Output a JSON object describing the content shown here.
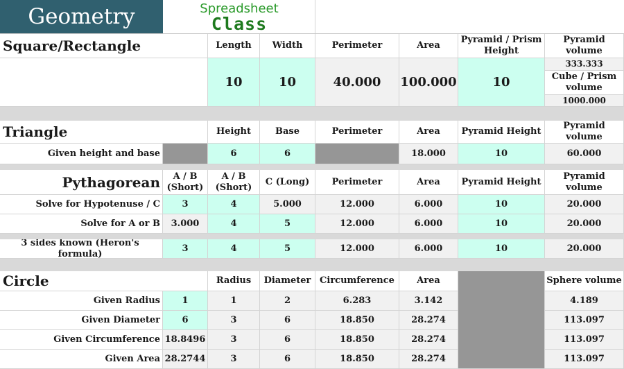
{
  "header": {
    "title": "Geometry",
    "brand_line1": "Spreadsheet",
    "brand_line2": "Class"
  },
  "square": {
    "title": "Square/Rectangle",
    "headers": {
      "length": "Length",
      "width": "Width",
      "perimeter": "Perimeter",
      "area": "Area",
      "height": "Pyramid / Prism Height",
      "pyr_vol": "Pyramid volume",
      "cube_vol": "Cube / Prism volume"
    },
    "values": {
      "length": "10",
      "width": "10",
      "perimeter": "40.000",
      "area": "100.000",
      "height": "10",
      "pyr_vol": "333.333",
      "cube_vol": "1000.000"
    }
  },
  "triangle": {
    "title": "Triangle",
    "headers": {
      "height": "Height",
      "base": "Base",
      "perimeter": "Perimeter",
      "area": "Area",
      "pyr_height": "Pyramid Height",
      "pyr_vol": "Pyramid volume"
    },
    "row": {
      "label": "Given height and base",
      "height": "6",
      "base": "6",
      "area": "18.000",
      "pyr_height": "10",
      "pyr_vol": "60.000"
    }
  },
  "pythagorean": {
    "title": "Pythagorean",
    "headers": {
      "a": "A / B (Short)",
      "b": "A / B (Short)",
      "c": "C (Long)",
      "perimeter": "Perimeter",
      "area": "Area",
      "pyr_height": "Pyramid Height",
      "pyr_vol": "Pyramid volume"
    },
    "rows": [
      {
        "label": "Solve for Hypotenuse / C",
        "a": "3",
        "b": "4",
        "c": "5.000",
        "perimeter": "12.000",
        "area": "6.000",
        "pyr_height": "10",
        "pyr_vol": "20.000"
      },
      {
        "label": "Solve for A or B",
        "a": "3.000",
        "b": "4",
        "c": "5",
        "perimeter": "12.000",
        "area": "6.000",
        "pyr_height": "10",
        "pyr_vol": "20.000"
      }
    ],
    "heron": {
      "label": "3 sides known (Heron's formula)",
      "a": "3",
      "b": "4",
      "c": "5",
      "perimeter": "12.000",
      "area": "6.000",
      "pyr_height": "10",
      "pyr_vol": "20.000"
    }
  },
  "circle": {
    "title": "Circle",
    "headers": {
      "radius": "Radius",
      "diameter": "Diameter",
      "circumference": "Circumference",
      "area": "Area",
      "sphere": "Sphere volume"
    },
    "rows": [
      {
        "label": "Given Radius",
        "input": "1",
        "radius": "1",
        "diameter": "2",
        "circumference": "6.283",
        "area": "3.142",
        "sphere": "4.189"
      },
      {
        "label": "Given Diameter",
        "input": "6",
        "radius": "3",
        "diameter": "6",
        "circumference": "18.850",
        "area": "28.274",
        "sphere": "113.097"
      },
      {
        "label": "Given Circumference",
        "input": "18.8496",
        "radius": "3",
        "diameter": "6",
        "circumference": "18.850",
        "area": "28.274",
        "sphere": "113.097"
      },
      {
        "label": "Given Area",
        "input": "28.2744",
        "radius": "3",
        "diameter": "6",
        "circumference": "18.850",
        "area": "28.274",
        "sphere": "113.097"
      }
    ]
  },
  "colors": {
    "header_bg": "#30606f",
    "input_bg": "#ccfff0",
    "output_bg": "#f1f1f1",
    "blocked_bg": "#969696",
    "band_bg": "#d9d9d9"
  }
}
